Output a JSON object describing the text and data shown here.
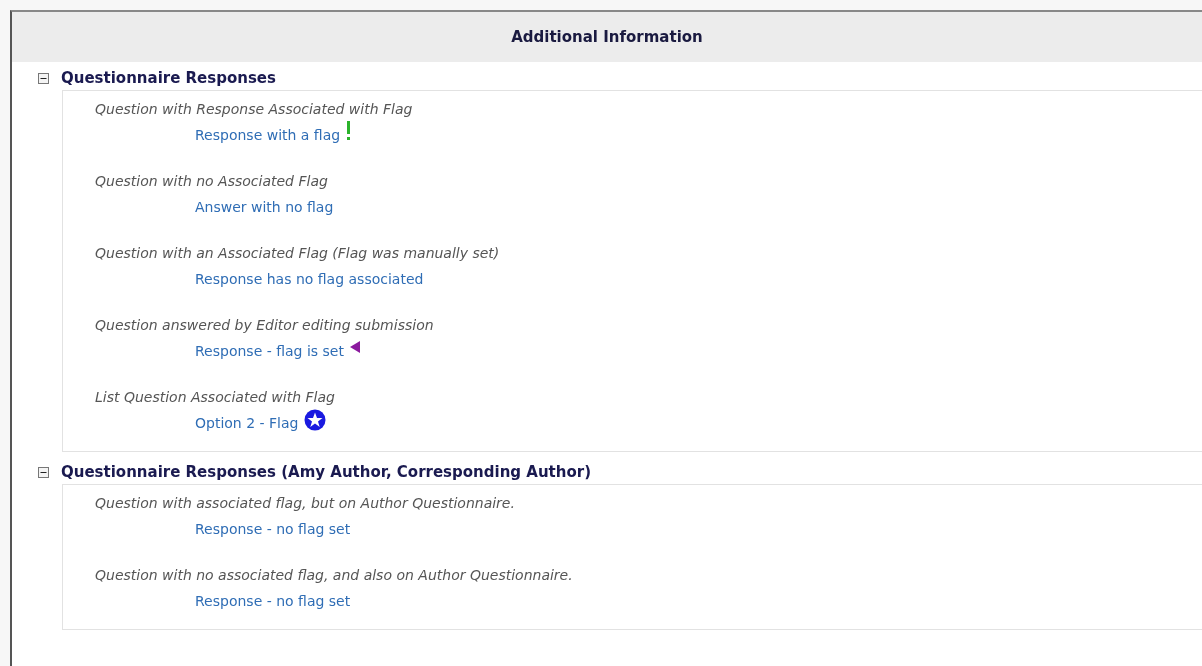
{
  "panel": {
    "title": "Additional Information"
  },
  "sections": [
    {
      "title": "Questionnaire Responses",
      "expanded": true,
      "items": [
        {
          "question": "Question with Response Associated with Flag",
          "answer": "Response with a flag",
          "flag": {
            "kind": "exclamation",
            "color": "#2bb32b"
          }
        },
        {
          "question": "Question with no Associated Flag",
          "answer": "Answer with no flag"
        },
        {
          "question": "Question with an Associated Flag (Flag was manually set)",
          "answer": "Response has no flag associated"
        },
        {
          "question": "Question answered by Editor editing submission",
          "answer": "Response - flag is set",
          "flag": {
            "kind": "triangle",
            "color": "#8b1a9e"
          }
        },
        {
          "question": "List Question Associated with Flag",
          "answer": "Option 2 - Flag",
          "flag": {
            "kind": "star",
            "color": "#1a1ae0"
          }
        }
      ]
    },
    {
      "title": "Questionnaire Responses (Amy Author, Corresponding Author)",
      "expanded": true,
      "items": [
        {
          "question": "Question with associated flag, but on Author Questionnaire.",
          "answer": "Response - no flag set"
        },
        {
          "question": "Question with no associated flag, and also on Author Questionnaire.",
          "answer": "Response - no flag set"
        }
      ]
    }
  ]
}
